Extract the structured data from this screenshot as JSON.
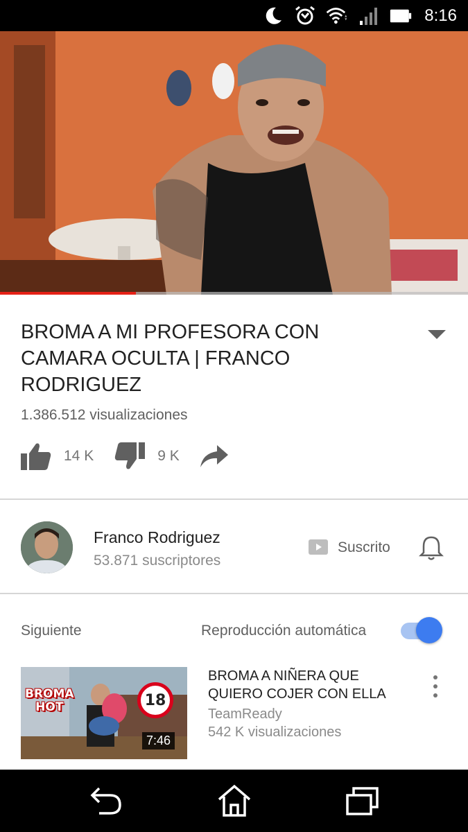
{
  "status_bar": {
    "time": "8:16",
    "icons": [
      "moon-icon",
      "alarm-icon",
      "wifi-icon",
      "cell-signal-icon",
      "battery-icon"
    ]
  },
  "player": {
    "progress_fraction": 0.29
  },
  "video": {
    "title": "BROMA A MI PROFESORA CON CAMARA OCULTA | FRANCO RODRIGUEZ",
    "views": "1.386.512 visualizaciones",
    "likes": "14 K",
    "dislikes": "9 K"
  },
  "channel": {
    "name": "Franco Rodriguez",
    "subscribers": "53.871 suscriptores",
    "subscribe_label": "Suscrito"
  },
  "up_next": {
    "label": "Siguiente",
    "autoplay_label": "Reproducción automática",
    "autoplay_on": true,
    "items": [
      {
        "title": "BROMA A NIÑERA QUE QUIERO COJER CON ELLA",
        "channel": "TeamReady",
        "views": "542 K visualizaciones",
        "duration": "7:46",
        "thumb_badge_line1": "BROMA",
        "thumb_badge_line2": "HOT",
        "thumb_age": "18"
      }
    ]
  },
  "colors": {
    "progress": "#e62117",
    "toggle_knob": "#3d7cf0",
    "toggle_track": "#a8c4f2",
    "text_primary": "#212121",
    "text_secondary": "#606060"
  }
}
